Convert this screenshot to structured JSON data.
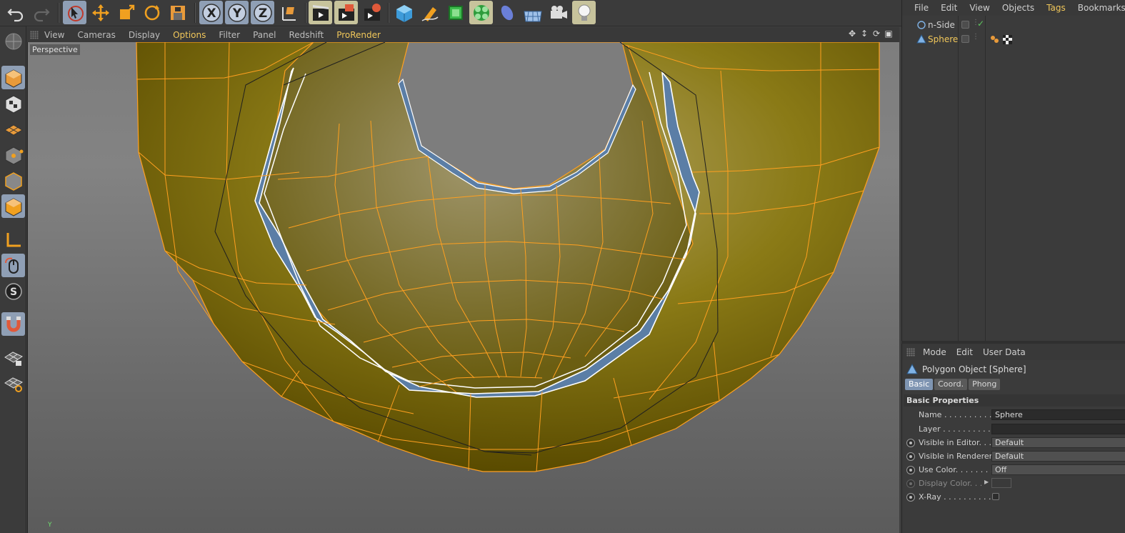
{
  "viewport": {
    "menu": [
      "View",
      "Cameras",
      "Display",
      "Options",
      "Filter",
      "Panel",
      "Redshift",
      "ProRender"
    ],
    "active_menu": "Options",
    "label": "Perspective",
    "axis_label": "Y"
  },
  "objects": {
    "menu": [
      "File",
      "Edit",
      "View",
      "Objects",
      "Tags",
      "Bookmarks"
    ],
    "active_menu": "Tags",
    "items": [
      {
        "name": "n-Side",
        "selected": false
      },
      {
        "name": "Sphere",
        "selected": true
      }
    ]
  },
  "attributes": {
    "menu": [
      "Mode",
      "Edit",
      "User Data"
    ],
    "title": "Polygon Object [Sphere]",
    "tabs": [
      "Basic",
      "Coord.",
      "Phong"
    ],
    "active_tab": "Basic",
    "section": "Basic Properties",
    "props": [
      {
        "label": "Name . . . . . . . . . . .",
        "value": "Sphere"
      },
      {
        "label": "Layer . . . . . . . . . . .",
        "value": ""
      },
      {
        "label": "Visible in Editor. . .",
        "value": "Default"
      },
      {
        "label": "Visible in Renderer",
        "value": "Default"
      },
      {
        "label": "Use Color. . . . . . . .",
        "value": "Off"
      },
      {
        "label": "Display Color. . .",
        "value": ""
      },
      {
        "label": "X-Ray . . . . . . . . . . .",
        "value": ""
      }
    ]
  },
  "colors": {
    "accent": "#f1c75a",
    "mesh_fill": "#8a7a16",
    "mesh_wire": "#ffa020",
    "selected_faces": "#5b7ea6",
    "active_button": "#8f9fb5"
  },
  "icons": {
    "top_toolbar": [
      "undo-icon",
      "redo-icon",
      "live-selection-icon",
      "move-icon",
      "scale-icon",
      "rotate-icon",
      "recent-tools-icon",
      "x-axis-icon",
      "y-axis-icon",
      "z-axis-icon",
      "coordinate-system-icon",
      "render-view-icon",
      "render-picture-viewer-icon",
      "render-settings-icon",
      "cube-icon",
      "pen-icon",
      "subdivision-icon",
      "cloner-icon",
      "deformer-icon",
      "floor-icon",
      "camera-icon",
      "light-icon"
    ],
    "left_toolbar": [
      "make-editable-icon",
      "texture-mode-icon",
      "workplane-icon",
      "points-mode-icon",
      "edges-mode-icon",
      "polygons-mode-icon",
      "axis-mode-icon",
      "tweak-mode-icon",
      "solo-icon",
      "snap-icon",
      "lock-workplane-icon",
      "planar-workplane-icon"
    ]
  }
}
